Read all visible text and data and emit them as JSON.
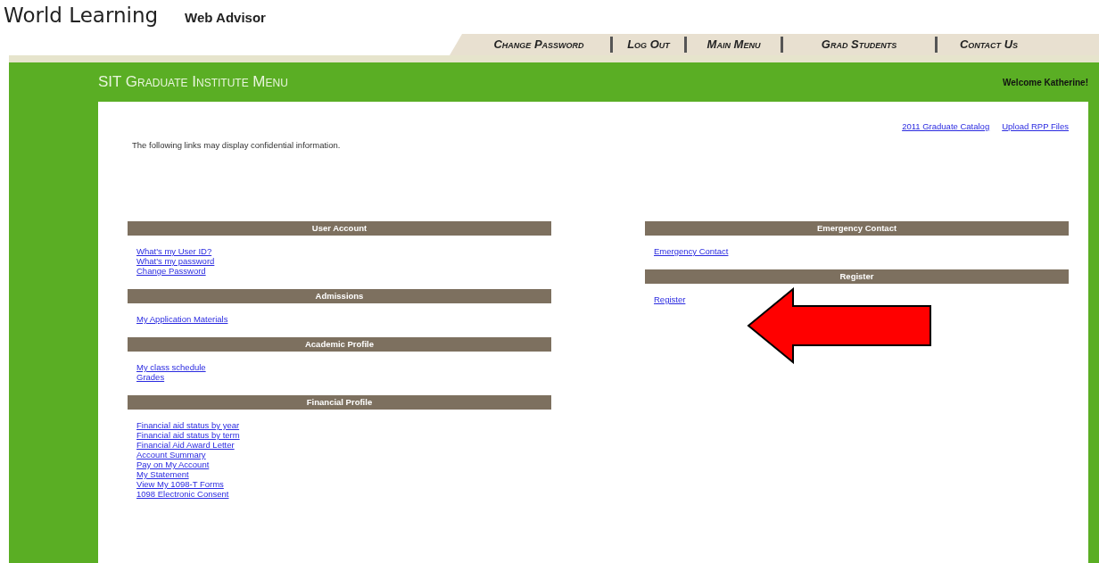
{
  "logo": {
    "brand": "World Learning",
    "product": "Web Advisor"
  },
  "nav": [
    {
      "label": "Change Password"
    },
    {
      "label": "Log Out"
    },
    {
      "label": "Main Menu"
    },
    {
      "label": "Grad Students"
    },
    {
      "label": "Contact Us"
    }
  ],
  "banner": {
    "title": "SIT Graduate Institute Menu",
    "welcome": "Welcome Katherine!"
  },
  "top_links": [
    "2011 Graduate Catalog",
    "Upload RPP Files"
  ],
  "notice": "The following links may display confidential information.",
  "columns": [
    [
      {
        "title": "User Account",
        "links": [
          "What's my User ID?",
          "What's my password",
          "Change Password"
        ]
      },
      {
        "title": "Admissions",
        "links": [
          "My Application Materials"
        ]
      },
      {
        "title": "Academic Profile",
        "links": [
          "My class schedule",
          "Grades"
        ]
      },
      {
        "title": "Financial Profile",
        "links": [
          "Financial aid status by year",
          "Financial aid status by term",
          "Financial Aid Award Letter",
          "Account Summary",
          "Pay on My Account",
          "My Statement",
          "View My 1098-T Forms",
          "1098 Electronic Consent"
        ]
      }
    ],
    [
      {
        "title": "Emergency Contact",
        "links": [
          "Emergency Contact"
        ]
      },
      {
        "title": "Register",
        "links": [
          "Register"
        ]
      }
    ]
  ],
  "annotation": {
    "kind": "arrow"
  }
}
